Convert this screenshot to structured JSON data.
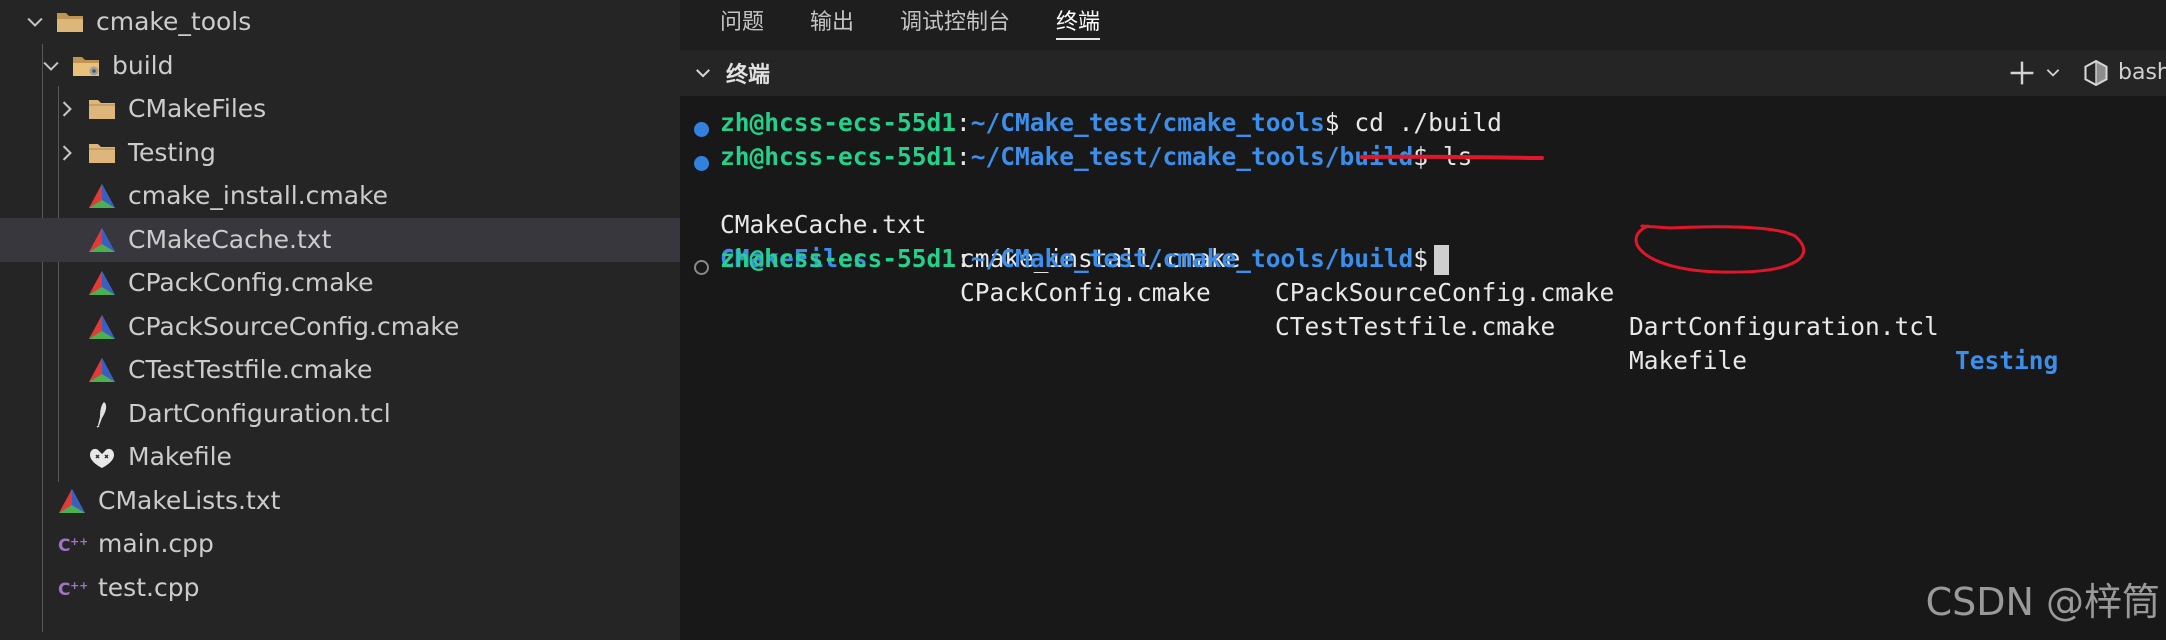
{
  "explorer": {
    "items": [
      {
        "label": "cmake_tools",
        "type": "folder-open",
        "depth": 0,
        "chevron": "down"
      },
      {
        "label": "build",
        "type": "folder-build",
        "depth": 1,
        "chevron": "down"
      },
      {
        "label": "CMakeFiles",
        "type": "folder",
        "depth": 2,
        "chevron": "right"
      },
      {
        "label": "Testing",
        "type": "folder",
        "depth": 2,
        "chevron": "right"
      },
      {
        "label": "cmake_install.cmake",
        "type": "cmake",
        "depth": 2
      },
      {
        "label": "CMakeCache.txt",
        "type": "cmake",
        "depth": 2,
        "selected": true
      },
      {
        "label": "CPackConfig.cmake",
        "type": "cmake",
        "depth": 2
      },
      {
        "label": "CPackSourceConfig.cmake",
        "type": "cmake",
        "depth": 2
      },
      {
        "label": "CTestTestfile.cmake",
        "type": "cmake",
        "depth": 2
      },
      {
        "label": "DartConfiguration.tcl",
        "type": "tcl",
        "depth": 2
      },
      {
        "label": "Makefile",
        "type": "makefile",
        "depth": 2
      },
      {
        "label": "CMakeLists.txt",
        "type": "cmake",
        "depth": 1
      },
      {
        "label": "main.cpp",
        "type": "cpp",
        "depth": 1
      },
      {
        "label": "test.cpp",
        "type": "cpp",
        "depth": 1
      }
    ]
  },
  "panel": {
    "tabs": [
      "问题",
      "输出",
      "调试控制台",
      "终端"
    ],
    "active_tab": "终端",
    "terminal_title": "终端",
    "shell_label": "bash"
  },
  "terminal": {
    "prompt_userhost": "zh@hcss-ecs-55d1",
    "line1_path": "~/CMake_test/cmake_tools",
    "line1_cmd": " cd ./build",
    "line2_path": "~/CMake_test/cmake_tools/build",
    "line2_cmd": " ls",
    "ls_row1": [
      "CMakeCache.txt",
      "cmake_install.cmake",
      "CPackSourceConfig.cmake",
      "DartConfiguration.tcl",
      "Testing"
    ],
    "ls_row2": [
      "CMakeFiles",
      "CPackConfig.cmake",
      "CTestTestfile.cmake",
      "Makefile"
    ],
    "line3_path": "~/CMake_test/cmake_tools/build"
  },
  "watermark": "CSDN @梓筒",
  "colors": {
    "user_host": "#23d18b",
    "path": "#3b8eea",
    "annotation": "#e0162b"
  }
}
